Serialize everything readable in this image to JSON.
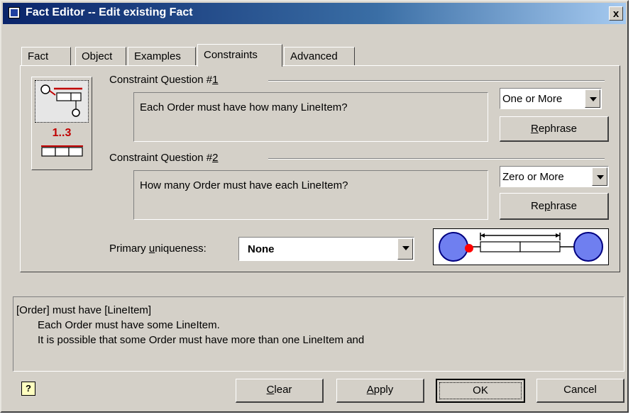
{
  "window": {
    "title": "Fact Editor -- Edit existing Fact",
    "close_label": "x"
  },
  "tabs": [
    {
      "label": "Fact",
      "active": false
    },
    {
      "label": "Object",
      "active": false
    },
    {
      "label": "Examples",
      "active": false
    },
    {
      "label": "Constraints",
      "active": true
    },
    {
      "label": "Advanced",
      "active": false
    }
  ],
  "picker": {
    "range_label": "1..3"
  },
  "constraint1": {
    "title_prefix": "Constraint Question #",
    "title_number": "1",
    "question": "Each Order must have how many LineItem?",
    "selected": "One or More",
    "rephrase_prefix": "",
    "rephrase_mnemonic": "R",
    "rephrase_rest": "ephrase"
  },
  "constraint2": {
    "title_prefix": "Constraint Question #",
    "title_number": "2",
    "question": "How many Order must have each LineItem?",
    "selected": "Zero or More",
    "rephrase_prefix": "Re",
    "rephrase_mnemonic": "p",
    "rephrase_rest": "hrase"
  },
  "primary_uniqueness": {
    "label_prefix": "Primary ",
    "label_mnemonic": "u",
    "label_rest": "niqueness:",
    "value": "None"
  },
  "description": {
    "lines": [
      "[Order] must have [LineItem]",
      "Each Order must have some LineItem.",
      "It is possible that some Order must have more than one LineItem and"
    ]
  },
  "buttons": {
    "help": "?",
    "clear_mnemonic": "C",
    "clear_rest": "lear",
    "apply_mnemonic": "A",
    "apply_rest": "pply",
    "ok": "OK",
    "cancel": "Cancel"
  },
  "colors": {
    "title_start": "#0a246a",
    "title_end": "#a6caf0",
    "entity_fill": "#6f7ff0",
    "entity_stroke": "#000080",
    "marker": "#ff0000",
    "dark_red": "#c00000"
  }
}
